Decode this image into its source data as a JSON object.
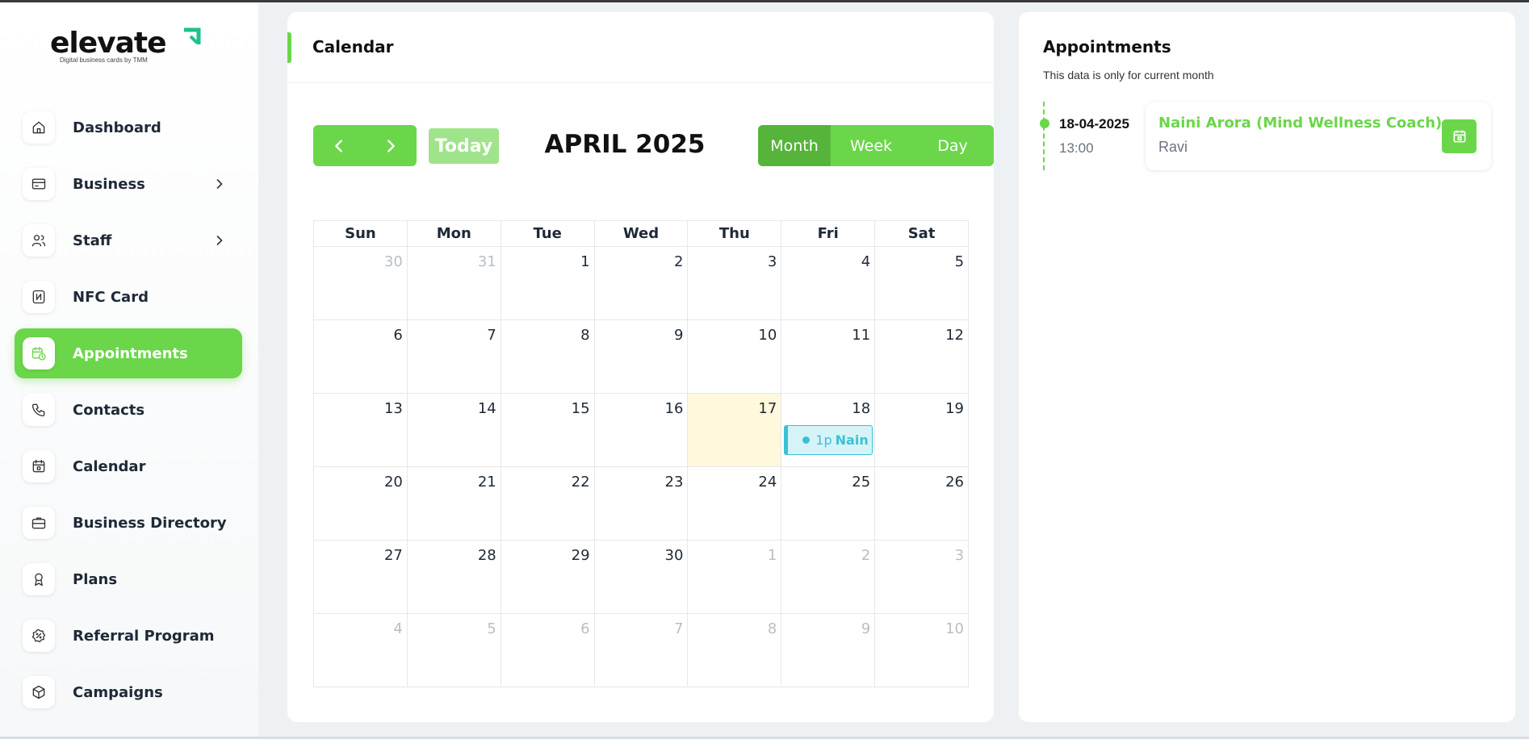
{
  "brand": {
    "logo_text": "elevate",
    "tagline": "Digital business cards by TMM",
    "accent_color": "#6bd64a"
  },
  "sidebar": {
    "items": [
      {
        "label": "Dashboard",
        "icon": "home-icon",
        "has_submenu": false,
        "active": false
      },
      {
        "label": "Business",
        "icon": "id-card-icon",
        "has_submenu": true,
        "active": false
      },
      {
        "label": "Staff",
        "icon": "users-icon",
        "has_submenu": true,
        "active": false
      },
      {
        "label": "NFC Card",
        "icon": "nfc-icon",
        "has_submenu": false,
        "active": false
      },
      {
        "label": "Appointments",
        "icon": "calendar-clock-icon",
        "has_submenu": false,
        "active": true
      },
      {
        "label": "Contacts",
        "icon": "phone-icon",
        "has_submenu": false,
        "active": false
      },
      {
        "label": "Calendar",
        "icon": "calendar-icon",
        "has_submenu": false,
        "active": false
      },
      {
        "label": "Business Directory",
        "icon": "briefcase-icon",
        "has_submenu": false,
        "active": false
      },
      {
        "label": "Plans",
        "icon": "award-icon",
        "has_submenu": false,
        "active": false
      },
      {
        "label": "Referral Program",
        "icon": "percent-badge-icon",
        "has_submenu": false,
        "active": false
      },
      {
        "label": "Campaigns",
        "icon": "box-icon",
        "has_submenu": false,
        "active": false
      }
    ]
  },
  "calendar": {
    "panel_title": "Calendar",
    "today_label": "Today",
    "month_title": "APRIL 2025",
    "views": [
      {
        "label": "Month",
        "selected": true
      },
      {
        "label": "Week",
        "selected": false
      },
      {
        "label": "Day",
        "selected": false
      }
    ],
    "weekdays": [
      "Sun",
      "Mon",
      "Tue",
      "Wed",
      "Thu",
      "Fri",
      "Sat"
    ],
    "weeks": [
      [
        {
          "d": "30",
          "other": true
        },
        {
          "d": "31",
          "other": true
        },
        {
          "d": "1"
        },
        {
          "d": "2"
        },
        {
          "d": "3"
        },
        {
          "d": "4"
        },
        {
          "d": "5"
        }
      ],
      [
        {
          "d": "6"
        },
        {
          "d": "7"
        },
        {
          "d": "8"
        },
        {
          "d": "9"
        },
        {
          "d": "10"
        },
        {
          "d": "11"
        },
        {
          "d": "12"
        }
      ],
      [
        {
          "d": "13"
        },
        {
          "d": "14"
        },
        {
          "d": "15"
        },
        {
          "d": "16"
        },
        {
          "d": "17",
          "today": true
        },
        {
          "d": "18",
          "event": {
            "time": "1p",
            "title": "Nain"
          }
        },
        {
          "d": "19"
        }
      ],
      [
        {
          "d": "20"
        },
        {
          "d": "21"
        },
        {
          "d": "22"
        },
        {
          "d": "23"
        },
        {
          "d": "24"
        },
        {
          "d": "25"
        },
        {
          "d": "26"
        }
      ],
      [
        {
          "d": "27"
        },
        {
          "d": "28"
        },
        {
          "d": "29"
        },
        {
          "d": "30"
        },
        {
          "d": "1",
          "other": true
        },
        {
          "d": "2",
          "other": true
        },
        {
          "d": "3",
          "other": true
        }
      ],
      [
        {
          "d": "4",
          "other": true
        },
        {
          "d": "5",
          "other": true
        },
        {
          "d": "6",
          "other": true
        },
        {
          "d": "7",
          "other": true
        },
        {
          "d": "8",
          "other": true
        },
        {
          "d": "9",
          "other": true
        },
        {
          "d": "10",
          "other": true
        }
      ]
    ]
  },
  "appointments": {
    "title": "Appointments",
    "subtitle": "This data is only for current month",
    "items": [
      {
        "date": "18-04-2025",
        "time": "13:00",
        "name": "Naini Arora (Mind Wellness Coach)",
        "with": "Ravi"
      }
    ]
  }
}
